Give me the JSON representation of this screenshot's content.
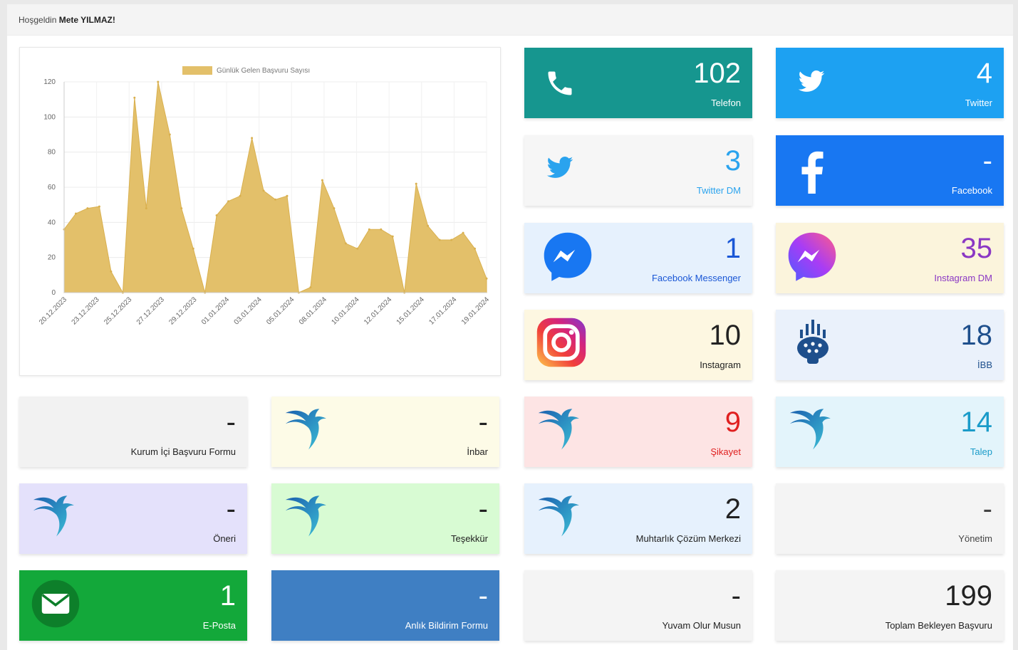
{
  "header": {
    "greeting": "Hoşgeldin",
    "user_name": "Mete YILMAZ!"
  },
  "chart_data": {
    "type": "area",
    "legend": "Günlük Gelen Başvuru Sayısı",
    "legend_position": "top",
    "color": "#e3c06a",
    "ylim": [
      0,
      120
    ],
    "yticks": [
      0,
      20,
      40,
      60,
      80,
      100,
      120
    ],
    "xtick_labels": [
      "20.12.2023",
      "23.12.2023",
      "25.12.2023",
      "27.12.2023",
      "29.12.2023",
      "01.01.2024",
      "03.01.2024",
      "05.01.2024",
      "08.01.2024",
      "10.01.2024",
      "12.01.2024",
      "15.01.2024",
      "17.01.2024",
      "19.01.2024"
    ],
    "values": [
      36,
      45,
      48,
      49,
      12,
      0,
      111,
      48,
      120,
      90,
      48,
      25,
      0,
      44,
      52,
      55,
      88,
      58,
      53,
      55,
      0,
      3,
      64,
      48,
      28,
      25,
      36,
      36,
      32,
      0,
      62,
      38,
      30,
      30,
      34,
      25,
      8
    ],
    "grid": true
  },
  "tiles": [
    {
      "id": "telefon",
      "value": "102",
      "label": "Telefon",
      "bg": "#16968f",
      "color": "#ffffff",
      "icon": "phone-icon"
    },
    {
      "id": "twitter",
      "value": "4",
      "label": "Twitter",
      "bg": "#1da1f2",
      "color": "#ffffff",
      "icon": "twitter-bird-icon"
    },
    {
      "id": "twitter-dm",
      "value": "3",
      "label": "Twitter DM",
      "bg": "#f6f6f6",
      "color": "#2aa3ee",
      "icon": "twitter-bird-icon"
    },
    {
      "id": "facebook",
      "value": "-",
      "label": "Facebook",
      "bg": "#1877f2",
      "color": "#ffffff",
      "icon": "facebook-icon"
    },
    {
      "id": "facebook-messenger",
      "value": "1",
      "label": "Facebook Messenger",
      "bg": "#e6f1fd",
      "color": "#1a57d6",
      "icon": "messenger-icon"
    },
    {
      "id": "instagram-dm",
      "value": "35",
      "label": "Instagram DM",
      "bg": "#fbf4dc",
      "color": "#8a37c4",
      "icon": "messenger-gradient-icon"
    },
    {
      "id": "instagram",
      "value": "10",
      "label": "Instagram",
      "bg": "#fdf7e1",
      "color": "#222222",
      "icon": "instagram-icon"
    },
    {
      "id": "ibb",
      "value": "18",
      "label": "İBB",
      "bg": "#eaf1fb",
      "color": "#1e4f8c",
      "icon": "ibb-logo-icon"
    },
    {
      "id": "kurum-ici",
      "value": "-",
      "label": "Kurum İçi Başvuru Formu",
      "bg": "#f2f2f2",
      "color": "#222222",
      "icon": ""
    },
    {
      "id": "inbar",
      "value": "-",
      "label": "İnbar",
      "bg": "#fdfbe7",
      "color": "#222222",
      "icon": "swallow-icon"
    },
    {
      "id": "sikayet",
      "value": "9",
      "label": "Şikayet",
      "bg": "#fde4e4",
      "color": "#e02020",
      "icon": "swallow-icon"
    },
    {
      "id": "talep",
      "value": "14",
      "label": "Talep",
      "bg": "#e3f4fb",
      "color": "#1a9bc9",
      "icon": "swallow-icon"
    },
    {
      "id": "oneri",
      "value": "-",
      "label": "Öneri",
      "bg": "#e4e1fb",
      "color": "#222222",
      "icon": "swallow-icon"
    },
    {
      "id": "tesekkur",
      "value": "-",
      "label": "Teşekkür",
      "bg": "#d8fbd3",
      "color": "#222222",
      "icon": "swallow-icon"
    },
    {
      "id": "muhtarlik",
      "value": "2",
      "label": "Muhtarlık Çözüm Merkezi",
      "bg": "#e6f1fd",
      "color": "#222222",
      "icon": "swallow-icon"
    },
    {
      "id": "yonetim",
      "value": "-",
      "label": "Yönetim",
      "bg": "#f4f4f4",
      "color": "#444444",
      "icon": ""
    },
    {
      "id": "e-posta",
      "value": "1",
      "label": "E-Posta",
      "bg": "#13a83a",
      "color": "#ffffff",
      "icon": "envelope-icon"
    },
    {
      "id": "anlik-bildirim",
      "value": "-",
      "label": "Anlık Bildirim Formu",
      "bg": "#3f7fc3",
      "color": "#ffffff",
      "icon": ""
    },
    {
      "id": "yuvam",
      "value": "-",
      "label": "Yuvam Olur Musun",
      "bg": "#f4f4f4",
      "color": "#222222",
      "icon": ""
    },
    {
      "id": "toplam",
      "value": "199",
      "label": "Toplam Bekleyen Başvuru",
      "bg": "#f4f4f4",
      "color": "#222222",
      "icon": ""
    }
  ]
}
